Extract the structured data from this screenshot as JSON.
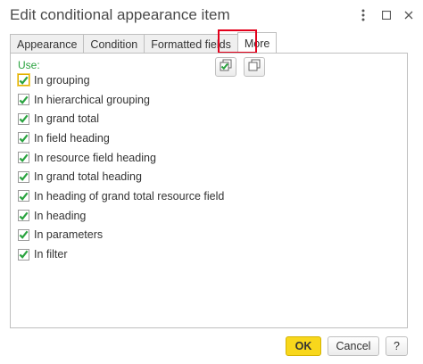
{
  "window": {
    "title": "Edit conditional appearance item",
    "menu_icon": "more-vertical-icon",
    "maximize_icon": "maximize-icon",
    "close_icon": "close-icon"
  },
  "tabs": [
    {
      "label": "Appearance"
    },
    {
      "label": "Condition"
    },
    {
      "label": "Formatted fields"
    },
    {
      "label": "More"
    }
  ],
  "active_tab": "More",
  "highlight_color": "#e3001b",
  "panel": {
    "use_label": "Use:",
    "toolbar": {
      "check_all_icon": "check-all-icon",
      "copy_icon": "copy-icon"
    },
    "items": [
      {
        "label": "In grouping",
        "checked": true
      },
      {
        "label": "In hierarchical grouping",
        "checked": true
      },
      {
        "label": "In grand total",
        "checked": true
      },
      {
        "label": "In field heading",
        "checked": true
      },
      {
        "label": "In resource field heading",
        "checked": true
      },
      {
        "label": "In grand total heading",
        "checked": true
      },
      {
        "label": "In heading of grand total resource field",
        "checked": true
      },
      {
        "label": "In heading",
        "checked": true
      },
      {
        "label": "In parameters",
        "checked": true
      },
      {
        "label": "In filter",
        "checked": true
      }
    ]
  },
  "footer": {
    "ok_label": "OK",
    "cancel_label": "Cancel",
    "help_label": "?"
  }
}
